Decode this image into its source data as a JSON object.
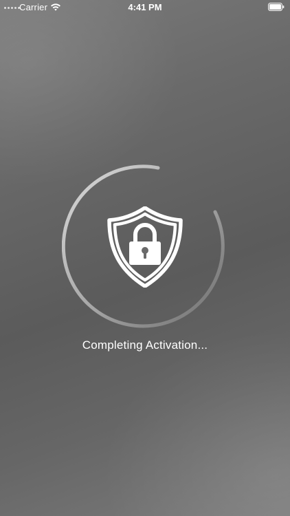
{
  "status_bar": {
    "carrier": "Carrier",
    "time": "4:41 PM",
    "icons": [
      "signal-dots-icon",
      "wifi-icon",
      "battery-icon"
    ]
  },
  "activation": {
    "message": "Completing Activation...",
    "icon": "shield-lock-icon",
    "spinner_icon": "progress-ring-icon",
    "colors": {
      "text": "#ffffff",
      "ring": "#d0d0d0",
      "background_start": "#7a7a7a",
      "background_end": "#5b5b5b"
    }
  }
}
